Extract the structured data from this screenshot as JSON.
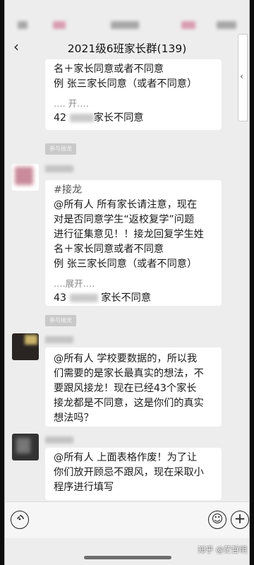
{
  "header": {
    "title": "2021级6班家长群(139)",
    "back_icon": "‹"
  },
  "messages": {
    "top": {
      "lines": [
        "名＋家长同意或者不同意",
        "例 张三家长同意（或者不同意）"
      ],
      "expand": "‥‥ 开‥‥",
      "reply_num": "42",
      "reply_text": "家长不同意"
    },
    "tag1": "参与接龙",
    "jielong": {
      "hashtag": "#接龙",
      "lines": [
        "@所有人  所有家长请注意，现在",
        "对是否同意学生“返校复学”问题",
        "进行征集意见！！接龙回复学生姓",
        "名＋家长同意或者不同意",
        "例 张三家长同意（或者不同意）"
      ],
      "expand": "‥‥展开‥‥",
      "reply_num": "43",
      "reply_text": "家长不同意"
    },
    "tag2": "参与接龙",
    "msg1": {
      "lines": [
        "@所有人  学校要数据的，所以我",
        "们需要的是家长最真实的想法，不",
        "要跟风接龙！现在已经43个家长",
        "接龙都是不同意，这是你们的真实",
        "想法吗？"
      ]
    },
    "msg2": {
      "lines": [
        "@所有人  上面表格作废！为了让",
        "你们放开顾忌不跟风，现在采取小",
        "程序进行填写"
      ]
    }
  },
  "input": {
    "voice_icon": "voice-icon",
    "emoji_icon": "emoji-icon",
    "plus_icon": "plus-icon"
  },
  "watermark": "知乎 @茫哲明"
}
